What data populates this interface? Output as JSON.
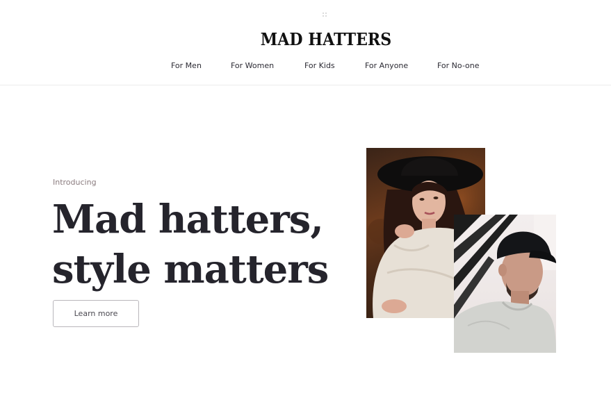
{
  "brand": {
    "name": "MAD HATTERS"
  },
  "nav": {
    "items": [
      {
        "label": "For Men"
      },
      {
        "label": "For Women"
      },
      {
        "label": "For Kids"
      },
      {
        "label": "For Anyone"
      },
      {
        "label": "For No-one"
      }
    ]
  },
  "hero": {
    "eyebrow": "Introducing",
    "headline_line1": "Mad hatters,",
    "headline_line2": "style matters",
    "cta_label": "Learn more"
  },
  "colors": {
    "text_dark": "#25242c",
    "eyebrow": "#8a7b7e",
    "button_border": "#b9b6bb",
    "divider": "#ececec"
  },
  "icons": {
    "drag_handle": "grip-dots-icon"
  }
}
